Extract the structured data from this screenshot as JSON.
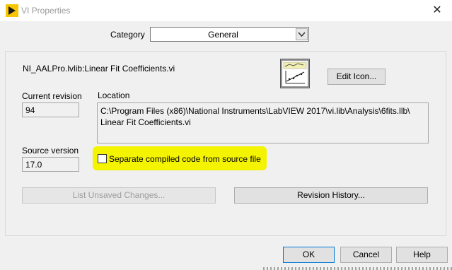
{
  "window": {
    "title": "VI Properties",
    "close_glyph": "✕",
    "app_icon": "labview-arrow-icon"
  },
  "category": {
    "label": "Category",
    "selected": "General"
  },
  "general": {
    "vi_path": "NI_AALPro.lvlib:Linear Fit Coefficients.vi",
    "edit_icon_button": "Edit Icon...",
    "current_revision_label": "Current revision",
    "current_revision_value": "94",
    "location_label": "Location",
    "location_line1": "C:\\Program Files (x86)\\National Instruments\\LabVIEW 2017\\vi.lib\\Analysis\\6fits.llb\\",
    "location_line2": "Linear Fit Coefficients.vi",
    "source_version_label": "Source version",
    "source_version_value": "17.0",
    "separate_compiled_label": "Separate compiled code from source file",
    "separate_compiled_checked": false,
    "highlight_color": "#f4f400",
    "list_unsaved_button": "List Unsaved Changes...",
    "revision_history_button": "Revision History..."
  },
  "footer": {
    "ok": "OK",
    "cancel": "Cancel",
    "help": "Help"
  }
}
